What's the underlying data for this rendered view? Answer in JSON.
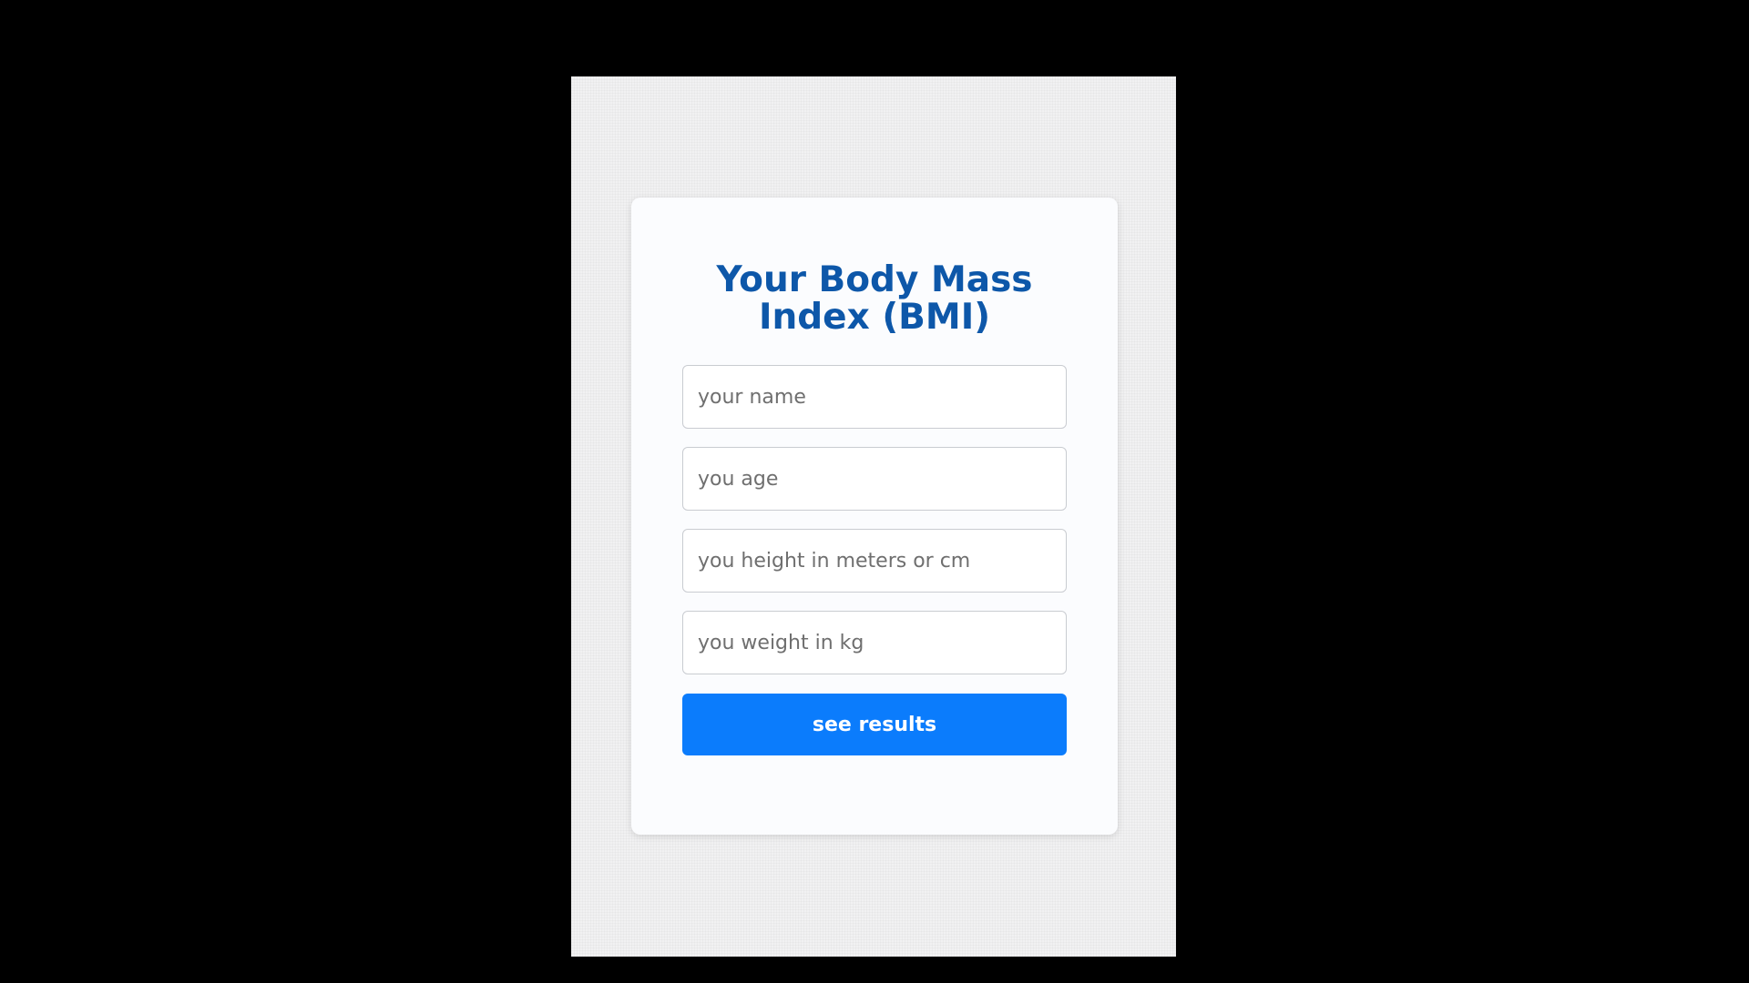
{
  "form": {
    "title_line1": "Your Body Mass",
    "title_line2": "Index (BMI)",
    "name_placeholder": "your name",
    "age_placeholder": "you age",
    "height_placeholder": "you height in meters or cm",
    "weight_placeholder": "you weight in kg",
    "submit_label": "see results"
  },
  "colors": {
    "outer_background": "#000000",
    "page_background": "#f1f1f2",
    "card_background": "#fbfcfe",
    "title": "#0d57a9",
    "button": "#0b7cfc",
    "button_text": "#ffffff"
  }
}
